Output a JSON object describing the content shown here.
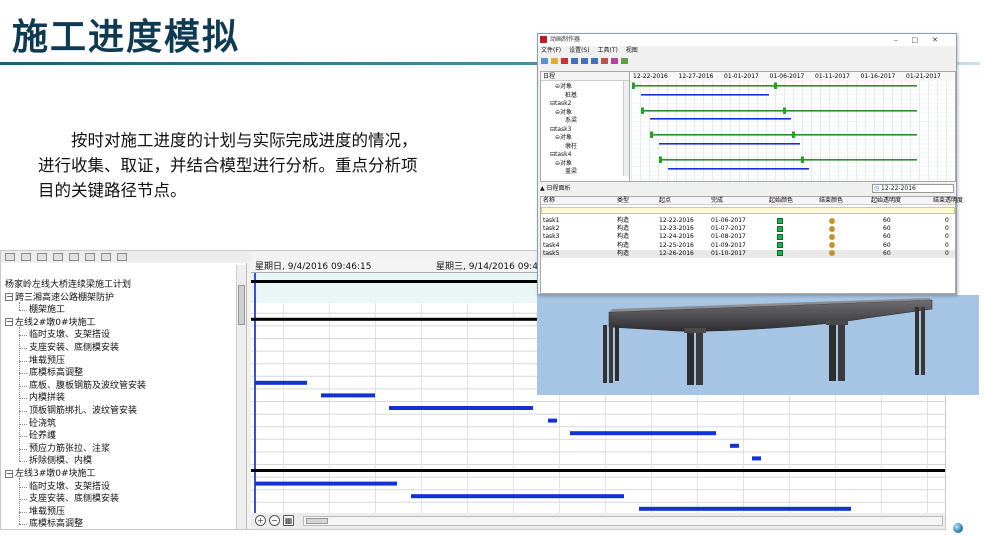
{
  "slide": {
    "title": "施工进度模拟",
    "body": "按时对施工进度的计划与实际完成进度的情况，进行收集、取证，并结合模型进行分析。重点分析项目的关键路径节点。"
  },
  "gantt": {
    "header_left": "星期日, 9/4/2016 09:46:15",
    "header_right": "星期三, 9/14/2016 09:46:15",
    "tree": [
      {
        "label": "杨家岭左线大桥连续梁施工计划",
        "level": 0,
        "expander": ""
      },
      {
        "label": "跨三湘高速公路棚架防护",
        "level": 1,
        "expander": "⊟"
      },
      {
        "label": "棚架施工",
        "level": 2,
        "expander": ""
      },
      {
        "label": "左线2#墩0#块施工",
        "level": 1,
        "expander": "⊟"
      },
      {
        "label": "临时支墩、支架搭设",
        "level": 2,
        "expander": ""
      },
      {
        "label": "支座安装、底侧模安装",
        "level": 2,
        "expander": ""
      },
      {
        "label": "堆载预压",
        "level": 2,
        "expander": ""
      },
      {
        "label": "底模标高调整",
        "level": 2,
        "expander": ""
      },
      {
        "label": "底板、腹板钢筋及波纹管安装",
        "level": 2,
        "expander": ""
      },
      {
        "label": "内模拼装",
        "level": 2,
        "expander": ""
      },
      {
        "label": "顶板钢筋绑扎、波纹管安装",
        "level": 2,
        "expander": ""
      },
      {
        "label": "砼浇筑",
        "level": 2,
        "expander": ""
      },
      {
        "label": "砼养護",
        "level": 2,
        "expander": ""
      },
      {
        "label": "预应力筋张拉、注浆",
        "level": 2,
        "expander": ""
      },
      {
        "label": "拆除侧模、内模",
        "level": 2,
        "expander": ""
      },
      {
        "label": "左线3#墩0#块施工",
        "level": 1,
        "expander": "⊟"
      },
      {
        "label": "临时支墩、支架搭设",
        "level": 2,
        "expander": ""
      },
      {
        "label": "支座安装、底侧模安装",
        "level": 2,
        "expander": ""
      },
      {
        "label": "堆载预压",
        "level": 2,
        "expander": ""
      },
      {
        "label": "底模标高调整",
        "level": 2,
        "expander": ""
      }
    ]
  },
  "anim": {
    "window_title": "动画制作器",
    "menu": [
      "文件(F)",
      "设置(S)",
      "工具(T)",
      "视图"
    ],
    "tree_header": "日程",
    "tree": [
      {
        "label": "⊖对象",
        "indent": 2
      },
      {
        "label": "桩基",
        "indent": 4
      },
      {
        "label": "⊟task2",
        "indent": 1
      },
      {
        "label": "⊖对象",
        "indent": 2
      },
      {
        "label": "系梁",
        "indent": 4
      },
      {
        "label": "⊟task3",
        "indent": 1
      },
      {
        "label": "⊖对象",
        "indent": 2
      },
      {
        "label": "墩柱",
        "indent": 4
      },
      {
        "label": "⊟task4",
        "indent": 1
      },
      {
        "label": "⊖对象",
        "indent": 2
      },
      {
        "label": "盖梁",
        "indent": 4
      }
    ],
    "dates": [
      "12-22-2016",
      "12-27-2016",
      "01-01-2017",
      "01-06-2017",
      "01-11-2017",
      "01-16-2017",
      "01-21-2017"
    ],
    "log_label": "日程面析",
    "date_value": "12-22-2016",
    "columns": [
      "名称",
      "类型",
      "起点",
      "完成",
      "起始颜色",
      "结束颜色",
      "起始透明度",
      "结束透明度"
    ],
    "rows": [
      [
        "task1",
        "构造",
        "12-22-2016",
        "01-06-2017",
        "",
        "",
        "60",
        "0"
      ],
      [
        "task2",
        "构造",
        "12-23-2016",
        "01-07-2017",
        "",
        "",
        "60",
        "0"
      ],
      [
        "task3",
        "构造",
        "12-24-2016",
        "01-08-2017",
        "",
        "",
        "60",
        "0"
      ],
      [
        "task4",
        "构造",
        "12-25-2016",
        "01-09-2017",
        "",
        "",
        "60",
        "0"
      ],
      [
        "task5",
        "构造",
        "12-26-2016",
        "01-10-2017",
        "",
        "",
        "60",
        "0"
      ]
    ]
  },
  "colors": {
    "title": "#0e3a52",
    "gantt_bar": "#1232d4",
    "milestone_bar": "#000000",
    "anim_green": "#2e8b2e",
    "anim_blue": "#1232d4",
    "model_bg": "#a6c4e4"
  },
  "icons": [
    "zoom-in-icon",
    "zoom-out-icon",
    "fit-icon",
    "app-logo-icon",
    "calendar-icon",
    "sphere-icon"
  ]
}
